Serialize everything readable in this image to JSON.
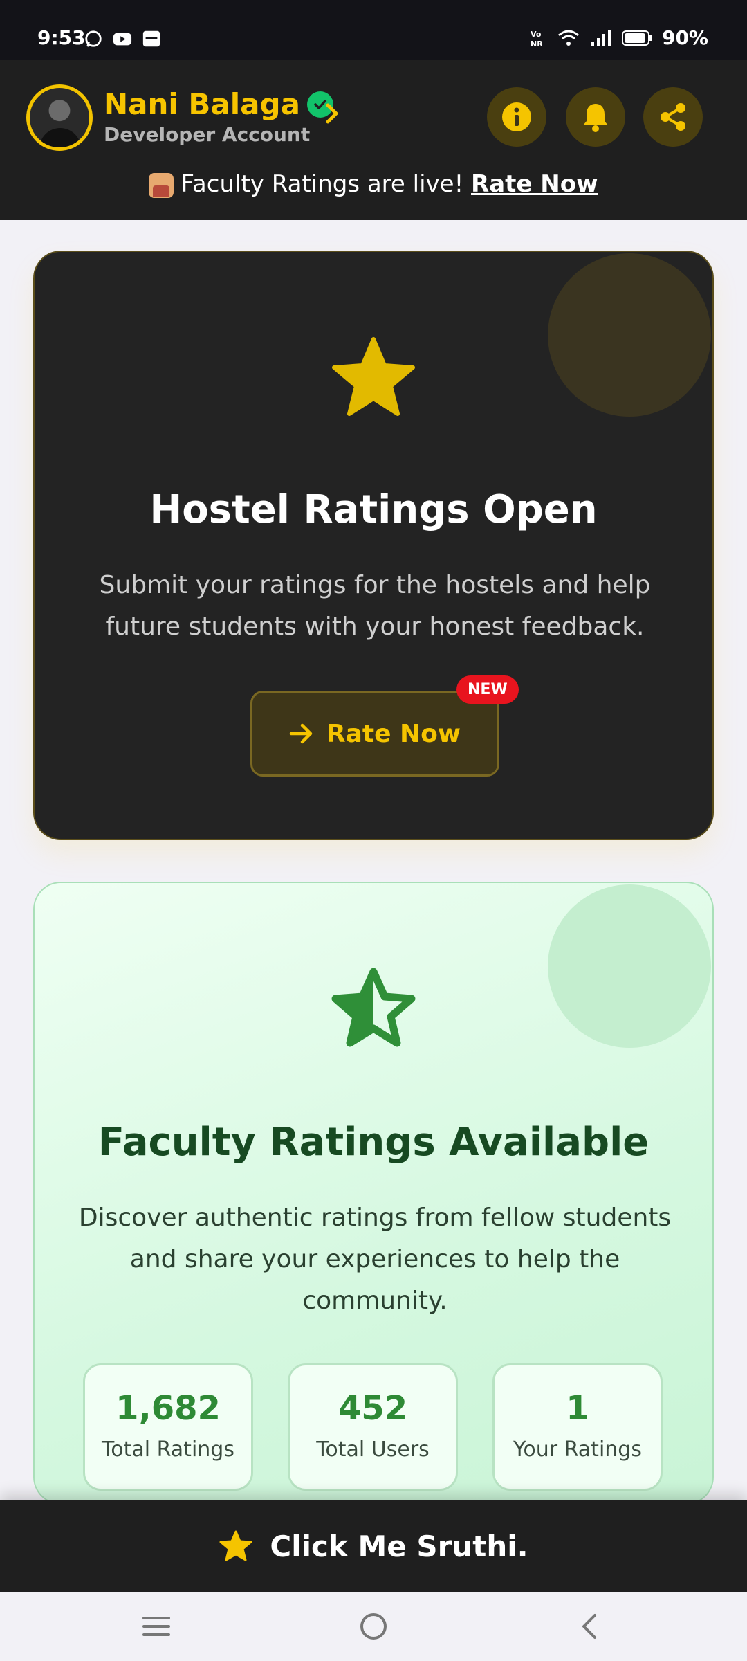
{
  "status_bar": {
    "time": "9:53",
    "battery": "90%",
    "left_icons": [
      "whatsapp-icon",
      "youtube-icon",
      "app-icon"
    ],
    "right_icons": [
      "volte-icon",
      "wifi-icon",
      "signal-icon",
      "battery-icon"
    ]
  },
  "header": {
    "user_name": "Nani Balaga",
    "account_type": "Developer Account",
    "verified": true,
    "buttons": [
      "info-icon",
      "bell-icon",
      "share-icon"
    ],
    "announcement_text": "Faculty Ratings are live! ",
    "announcement_link": "Rate Now"
  },
  "hostel_card": {
    "title": "Hostel Ratings Open",
    "description": "Submit your ratings for the hostels and help future students with your honest feedback.",
    "button_label": "Rate Now",
    "badge": "NEW"
  },
  "faculty_card": {
    "title": "Faculty Ratings Available",
    "description": "Discover authentic ratings from fellow students and share your experiences to help the community.",
    "stats": [
      {
        "value": "1,682",
        "label": "Total Ratings"
      },
      {
        "value": "452",
        "label": "Total Users"
      },
      {
        "value": "1",
        "label": "Your Ratings"
      }
    ]
  },
  "bottom_bar": {
    "label": "Click Me Sruthi."
  },
  "colors": {
    "accent_yellow": "#f5c400",
    "header_bg": "#1f1f1f",
    "green_text": "#2e8a35",
    "badge_red": "#e8141e"
  },
  "navbar": [
    "menu-icon",
    "home-icon",
    "back-icon"
  ]
}
